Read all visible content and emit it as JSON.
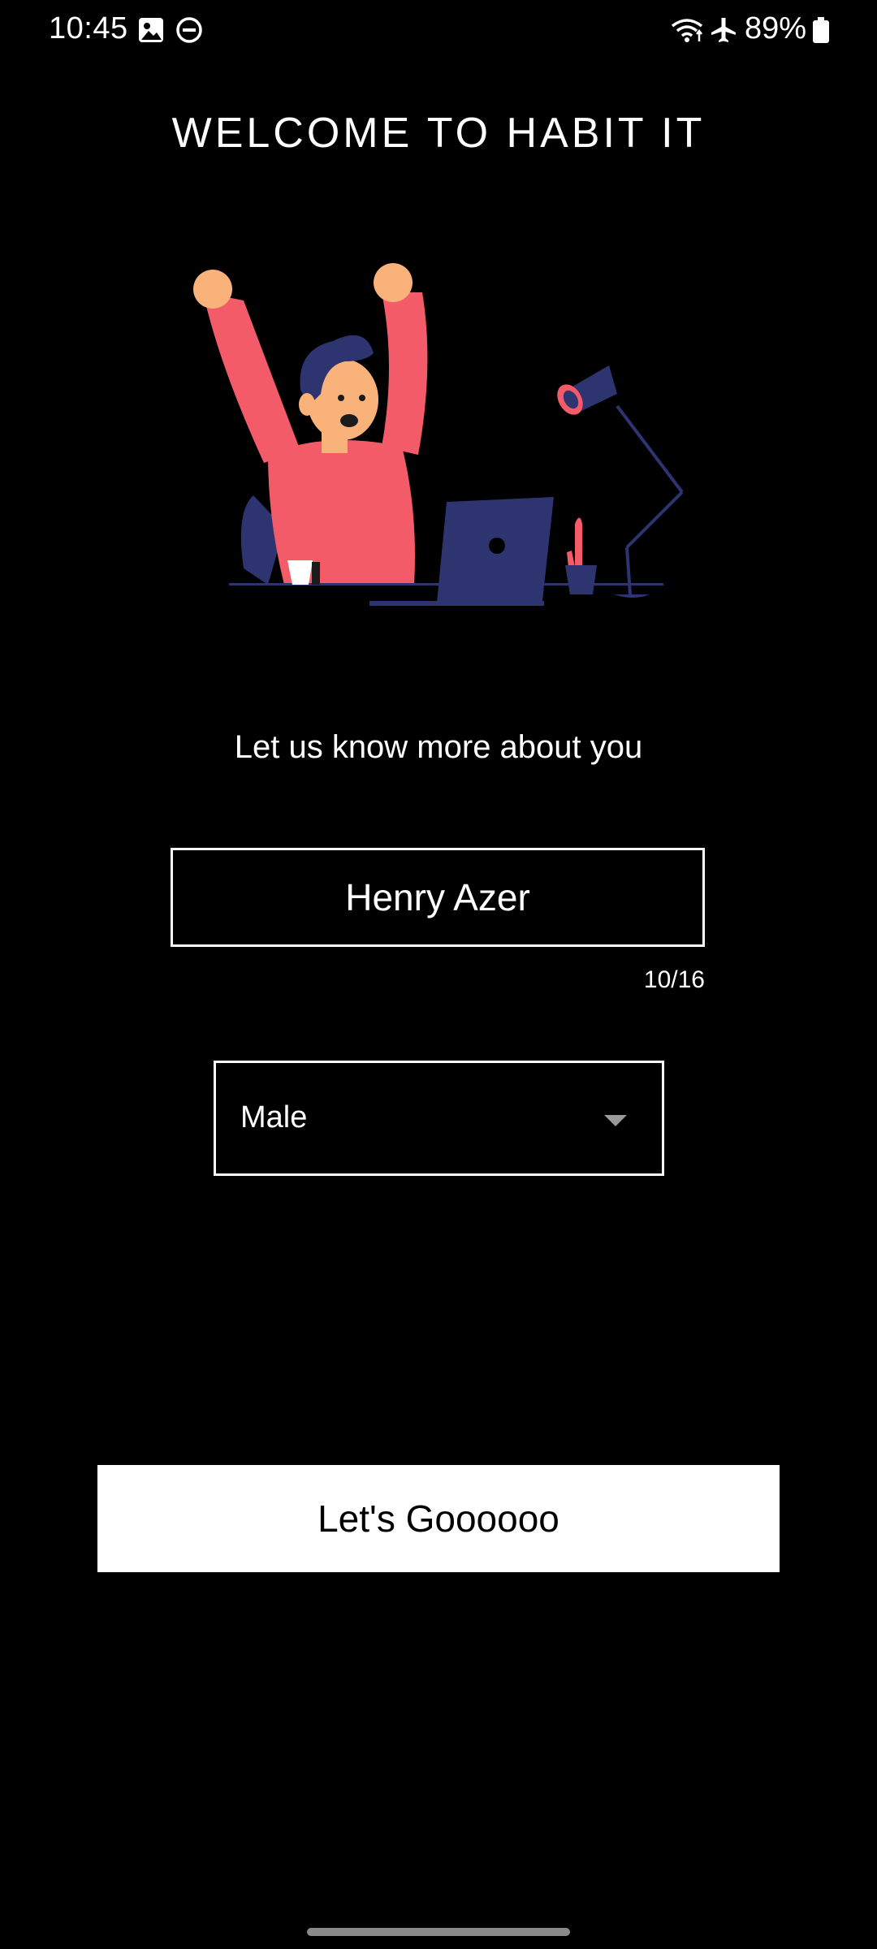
{
  "status_bar": {
    "time": "10:45",
    "battery_percent": "89%",
    "icons": [
      "gallery-icon",
      "dnd-icon",
      "wifi-icon",
      "airplane-icon",
      "battery-icon"
    ]
  },
  "title": "WELCOME TO HABIT IT",
  "illustration": {
    "name": "celebrating-person-at-laptop",
    "colors": {
      "shirt": "#f45b69",
      "hair": "#2d3470",
      "skin": "#f9b27a",
      "laptop": "#2d3470",
      "lamp_shade": "#2d3470",
      "accent": "#f45b69"
    }
  },
  "prompt": "Let us know more about you",
  "form": {
    "name_value": "Henry Azer",
    "name_counter": "10/16",
    "gender_selected": "Male"
  },
  "primary_button": "Let's Goooooo",
  "colors": {
    "background": "#000000",
    "foreground": "#ffffff",
    "button_bg": "#ffffff",
    "button_text": "#000000"
  }
}
